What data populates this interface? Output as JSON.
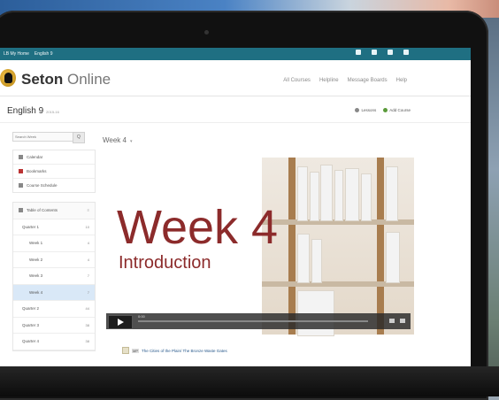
{
  "topbar": {
    "crumbs": [
      "LB My Home",
      "English 9"
    ],
    "icons": [
      "gear-icon",
      "mail-icon",
      "pencil-icon",
      "user-icon"
    ]
  },
  "header": {
    "logo_brand": "Seton",
    "logo_suffix": "Online",
    "nav": [
      "All Courses",
      "Helpline",
      "Message Boards",
      "Help"
    ]
  },
  "course": {
    "title": "English 9",
    "term": "2015-16",
    "actions": [
      "Lessons",
      "Add Course"
    ]
  },
  "sidebar": {
    "search_placeholder": "Search Week",
    "search_button": "Q",
    "links": [
      {
        "label": "Calendar",
        "icon": "calendar-icon"
      },
      {
        "label": "Bookmarks",
        "icon": "bookmark-icon"
      },
      {
        "label": "Course Schedule",
        "icon": "schedule-icon"
      }
    ],
    "toc_header": "Table of Contents",
    "toc": [
      {
        "label": "Quarter 1",
        "badge": "10"
      },
      {
        "label": "Week 1",
        "badge": "4"
      },
      {
        "label": "Week 2",
        "badge": "4"
      },
      {
        "label": "Week 3",
        "badge": "7"
      },
      {
        "label": "Week 4",
        "badge": "7"
      },
      {
        "label": "Quarter 2",
        "badge": "44"
      },
      {
        "label": "Quarter 3",
        "badge": "38"
      },
      {
        "label": "Quarter 4",
        "badge": "38"
      }
    ]
  },
  "main": {
    "week_label": "Week 4",
    "video": {
      "title": "Week 4",
      "subtitle": "Introduction",
      "time": "0:00"
    },
    "lesson": {
      "badge": "MP",
      "text": "The Cities of the Plain/ The Bronze Waste Gates"
    }
  },
  "colors": {
    "topbar": "#1f6f82",
    "title_red": "#8c2b2b",
    "active_row": "#d9e8f7"
  }
}
